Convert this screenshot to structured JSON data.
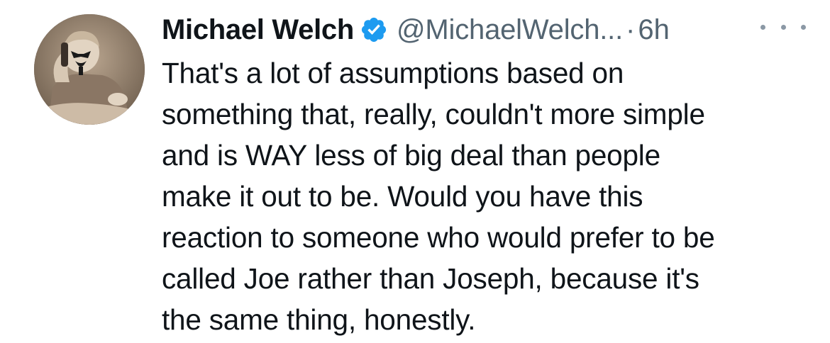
{
  "tweet": {
    "author_name": "Michael Welch",
    "handle": "@MichaelWelch...",
    "separator": "·",
    "timestamp": "6h",
    "verified": true,
    "verified_color": "#1d9bf0",
    "body_lines": [
      "That's a lot of assumptions based on",
      "something that, really, couldn't more simple",
      "and is WAY less of big deal than people",
      "make it out to be. Would you have this",
      "reaction to someone who would prefer to be",
      "called Joe rather than Joseph, because it's",
      "the same thing, honestly."
    ]
  },
  "icons": {
    "verified": "verified-badge-icon",
    "more": "more-options-icon"
  }
}
